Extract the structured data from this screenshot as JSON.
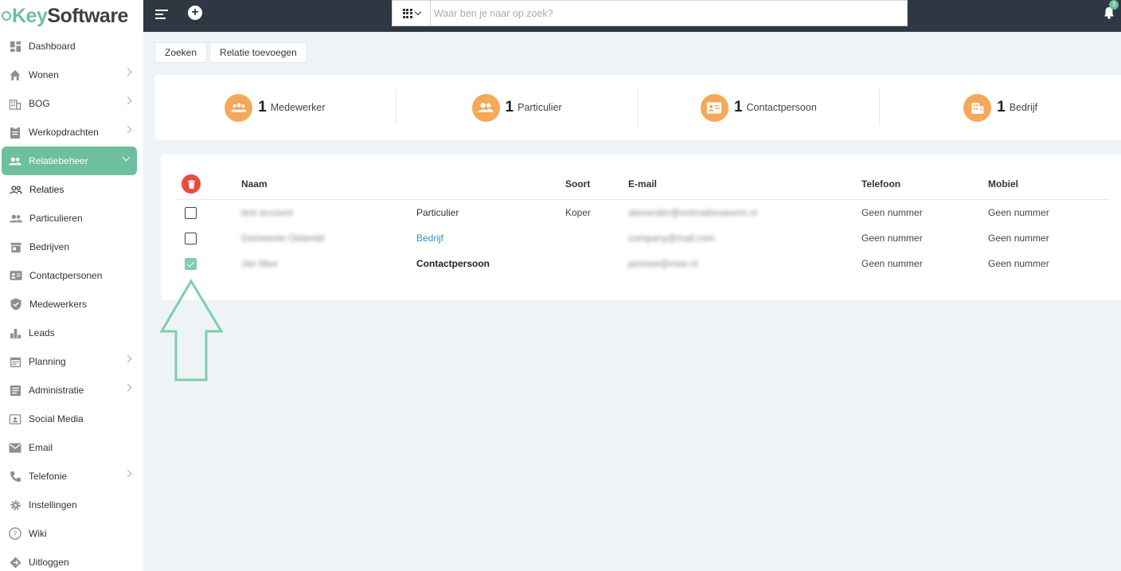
{
  "brand": {
    "prefix": "Key",
    "suffix": "Software",
    "accent": "#6dbf9d"
  },
  "sidebar": {
    "items": [
      {
        "label": "Dashboard",
        "icon": "dashboard-icon",
        "chevron": false
      },
      {
        "label": "Wonen",
        "icon": "home-icon",
        "chevron": true
      },
      {
        "label": "BOG",
        "icon": "building-icon",
        "chevron": true
      },
      {
        "label": "Werkopdrachten",
        "icon": "clipboard-icon",
        "chevron": true
      },
      {
        "label": "Relatiebeheer",
        "icon": "people-icon",
        "chevron": true,
        "active": true
      },
      {
        "label": "Relaties",
        "icon": "people-outline-icon",
        "sub": true,
        "current": true
      },
      {
        "label": "Particulieren",
        "icon": "people-icon",
        "sub": true
      },
      {
        "label": "Bedrijven",
        "icon": "store-icon",
        "sub": true
      },
      {
        "label": "Contactpersonen",
        "icon": "contact-card-icon",
        "sub": true
      },
      {
        "label": "Medewerkers",
        "icon": "shield-icon",
        "sub": true
      },
      {
        "label": "Leads",
        "icon": "bar-chart-icon"
      },
      {
        "label": "Planning",
        "icon": "calendar-icon",
        "chevron": true
      },
      {
        "label": "Administratie",
        "icon": "document-icon",
        "chevron": true
      },
      {
        "label": "Social Media",
        "icon": "social-media-icon"
      },
      {
        "label": "Email",
        "icon": "mail-icon"
      },
      {
        "label": "Telefonie",
        "icon": "phone-icon",
        "chevron": true
      },
      {
        "label": "Instellingen",
        "icon": "gear-icon"
      },
      {
        "label": "Wiki",
        "icon": "help-icon"
      },
      {
        "label": "Uitloggen",
        "icon": "logout-icon"
      }
    ]
  },
  "topbar": {
    "search_placeholder": "Waar ben je naar op zoek?",
    "notification_count": "3"
  },
  "actions": {
    "search_label": "Zoeken",
    "add_label": "Relatie toevoegen"
  },
  "stats": [
    {
      "count": "1",
      "label": "Medewerker",
      "icon": "team-icon"
    },
    {
      "count": "1",
      "label": "Particulier",
      "icon": "people-icon"
    },
    {
      "count": "1",
      "label": "Contactpersoon",
      "icon": "contact-card-icon"
    },
    {
      "count": "1",
      "label": "Bedrijf",
      "icon": "building-icon"
    }
  ],
  "table": {
    "headers": {
      "name": "Naam",
      "kind": "Soort",
      "email": "E-mail",
      "phone": "Telefoon",
      "mobile": "Mobiel"
    },
    "rows": [
      {
        "checked": false,
        "name": "test account",
        "type": "Particulier",
        "kind": "Koper",
        "email": "alexander@ontmattsoasens.nl",
        "phone": "Geen nummer",
        "mobile": "Geen nummer"
      },
      {
        "checked": false,
        "name": "Gemeente Oldambt",
        "type": "Bedrijf",
        "kind": "",
        "email": "company@mail.com",
        "phone": "Geen nummer",
        "mobile": "Geen nummer"
      },
      {
        "checked": true,
        "name": "Jan Mee",
        "type": "Contactpersoon",
        "kind": "",
        "email": "janmee@mee.nl",
        "phone": "Geen nummer",
        "mobile": "Geen nummer"
      }
    ]
  },
  "colors": {
    "topbar": "#2f3842",
    "stat_icon": "#f5a85a",
    "delete": "#e74c3c",
    "link": "#3a8ed6"
  }
}
